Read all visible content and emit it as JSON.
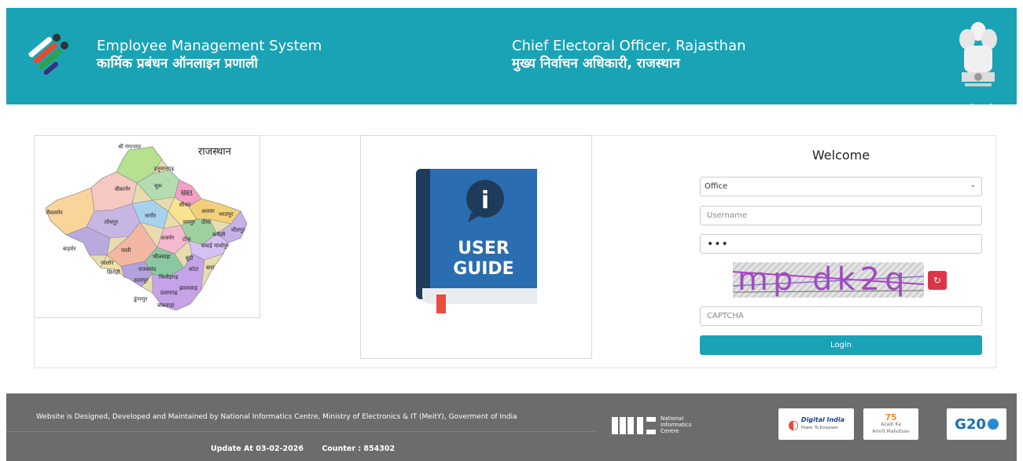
{
  "header": {
    "system_title_en": "Employee Management System",
    "system_title_hi": "कार्मिक प्रबंधन ऑनलाइन प्रणाली",
    "office_title_en": "Chief Electoral Officer, Rajasthan",
    "office_title_hi": "मुख्य निर्वाचन अधिकारी, राजस्थान",
    "emblem_caption": "सत्यमेव जयते"
  },
  "map": {
    "title": "राजस्थान",
    "districts": [
      "श्री गंगानगर",
      "हनुमानगढ़",
      "बीकानेर",
      "चूरू",
      "झुंझुनू",
      "सीकर",
      "अलवर",
      "भरतपुर",
      "जैसलमेर",
      "जोधपुर",
      "नागौर",
      "जयपुर",
      "दौसा",
      "धौलपुर",
      "करौली",
      "अजमेर",
      "टोंक",
      "सवाई माधोपुर",
      "बाड़मेर",
      "पाली",
      "भीलवाड़ा",
      "बूंदी",
      "जालोर",
      "सिरोही",
      "राजसमंद",
      "चित्तौड़गढ़",
      "कोटा",
      "बारां",
      "उदयपुर",
      "झालावाड़",
      "डूंगरपुर",
      "प्रतापगढ़",
      "बांसवाड़ा"
    ]
  },
  "guide": {
    "line1": "USER",
    "line2": "GUIDE",
    "info_glyph": "i"
  },
  "login": {
    "welcome": "Welcome",
    "role_selected": "Office",
    "role_options": [
      "Office"
    ],
    "username_placeholder": "Username",
    "username_value": "",
    "password_value": "•••",
    "captcha_text": "mp dk2q",
    "captcha_placeholder": "CAPTCHA",
    "refresh_glyph": "↻",
    "login_label": "Login"
  },
  "footer": {
    "credit": "Website is Designed, Developed and Maintained by National Informatics Centre, Ministry of Electronics & IT (MeitY), Goverment of India",
    "update": "Update At 03-02-2026",
    "counter": "Counter : 854302",
    "nic_text_1": "National",
    "nic_text_2": "Informatics",
    "nic_text_3": "Centre",
    "digital_india": "Digital India",
    "digital_india_sub": "Power To Empower",
    "azadi_1": "Azadi",
    "azadi_2": "Ka",
    "azadi_3": "Amrit Mahotsav",
    "g20": "G20"
  },
  "colors": {
    "brand": "#1aa3b5",
    "footer": "#6c6c6c",
    "danger": "#dc3545"
  }
}
